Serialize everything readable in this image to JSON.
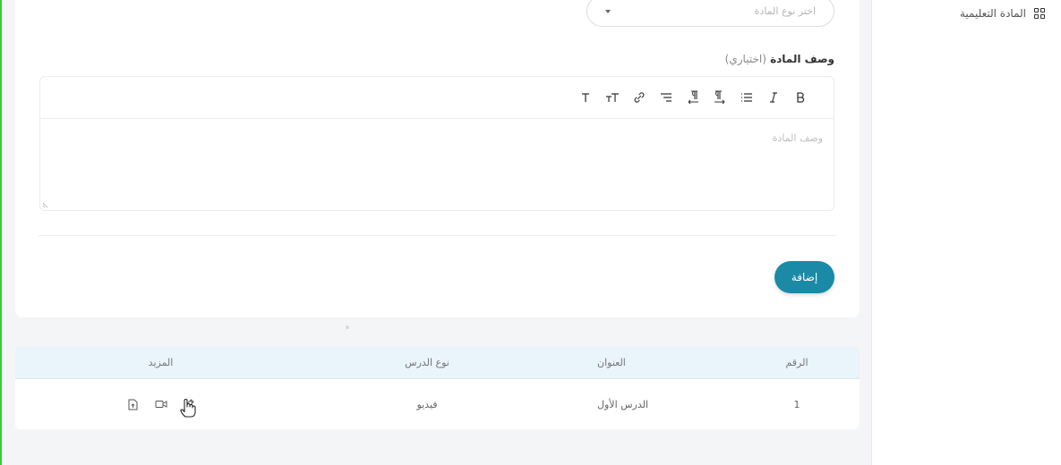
{
  "sidebar": {
    "items": [
      {
        "label": "المادة التعليمية",
        "icon": "grid-icon"
      }
    ]
  },
  "form": {
    "subject_type_select": {
      "placeholder": "اختر نوع المادة",
      "icon": "caret-down-icon"
    },
    "description": {
      "label": "وصف المادة",
      "optional_label": "(اختياري)",
      "placeholder": "وصف المادة",
      "toolbar": [
        {
          "name": "bold-icon",
          "glyph": "B"
        },
        {
          "name": "italic-icon",
          "glyph": "I"
        },
        {
          "name": "unordered-list-icon",
          "glyph": "list"
        },
        {
          "name": "paragraph-rtl-icon",
          "glyph": "pilcrow-rtl"
        },
        {
          "name": "paragraph-ltr-icon",
          "glyph": "pilcrow-ltr"
        },
        {
          "name": "ordered-list-icon",
          "glyph": "olist"
        },
        {
          "name": "link-icon",
          "glyph": "link"
        },
        {
          "name": "font-size-icon",
          "glyph": "TT"
        },
        {
          "name": "text-icon",
          "glyph": "T"
        }
      ]
    },
    "add_button": "إضافة"
  },
  "table": {
    "headers": {
      "number": "الرقم",
      "title": "العنوان",
      "type": "نوع الدرس",
      "more": "المزيد"
    },
    "rows": [
      {
        "number": "1",
        "title": "الدرس الأول",
        "type": "فيديو",
        "actions": [
          "edit-icon",
          "video-icon",
          "file-upload-icon"
        ]
      }
    ]
  },
  "colors": {
    "accent": "#1a8aa6",
    "table_header_bg": "#e9f4fb",
    "frame_edge": "#3cc93c"
  }
}
